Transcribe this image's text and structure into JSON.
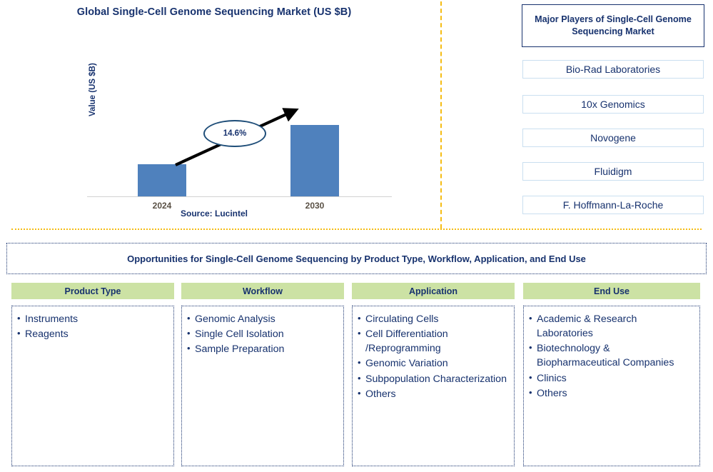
{
  "chart_panel": {
    "title": "Global Single-Cell Genome Sequencing Market (US $B)",
    "y_axis_label": "Value (US $B)",
    "cagr_label": "14.6%",
    "source": "Source: Lucintel"
  },
  "chart_data": {
    "type": "bar",
    "title": "Global Single-Cell Genome Sequencing Market (US $B)",
    "categories": [
      "2024",
      "2030"
    ],
    "values": [
      1.5,
      3.4
    ],
    "xlabel": "",
    "ylabel": "Value (US $B)",
    "ylim": [
      0,
      4
    ],
    "grid": false,
    "legend": "none",
    "bar_color": "#4f81bd",
    "annotations": [
      {
        "text": "14.6%",
        "note": "CAGR growth arrow from 2024 bar to 2030 bar"
      }
    ],
    "tick_labels": [
      "2024",
      "2030"
    ]
  },
  "players": {
    "header": "Major Players of Single-Cell Genome Sequencing Market",
    "items": [
      "Bio-Rad Laboratories",
      "10x Genomics",
      "Novogene",
      "Fluidigm",
      "F. Hoffmann-La-Roche"
    ]
  },
  "opportunities": {
    "banner": "Opportunities for Single-Cell Genome Sequencing by Product Type, Workflow, Application, and End Use",
    "columns": [
      {
        "header": "Product Type",
        "items": [
          "Instruments",
          "Reagents"
        ]
      },
      {
        "header": "Workflow",
        "items": [
          "Genomic Analysis",
          "Single Cell Isolation",
          "Sample Preparation"
        ]
      },
      {
        "header": "Application",
        "items": [
          "Circulating Cells",
          "Cell Differentiation /Reprogramming",
          "Genomic Variation",
          "Subpopulation Characterization",
          "Others"
        ]
      },
      {
        "header": "End Use",
        "items": [
          "Academic & Research Laboratories",
          "Biotechnology & Biopharmaceutical Companies",
          "Clinics",
          "Others"
        ]
      }
    ]
  },
  "colors": {
    "navy": "#17326e",
    "bar_blue": "#4f81bd",
    "header_green": "#cce2a4",
    "divider_yellow": "#f5bc13",
    "player_border": "#cadff0"
  }
}
